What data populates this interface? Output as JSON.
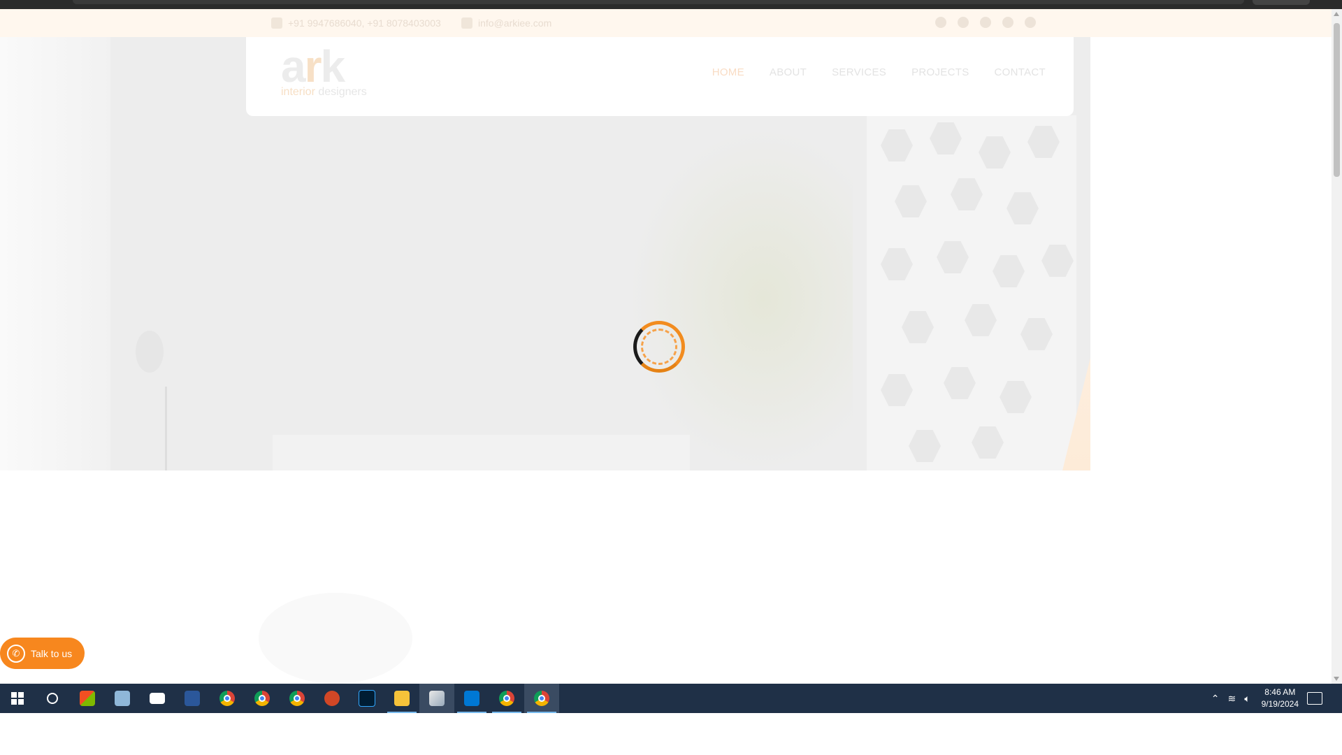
{
  "topbar": {
    "phone": "+91 9947686040, +91 8078403003",
    "email": "info@arkiee.com"
  },
  "logo": {
    "word_main": "a",
    "word_accent": "r",
    "word_end": "k",
    "tag_accent": "interior",
    "tag_rest": " designers"
  },
  "nav": {
    "items": [
      "HOME",
      "ABOUT",
      "SERVICES",
      "PROJECTS",
      "CONTACT"
    ],
    "active": "HOME"
  },
  "talk_button": {
    "label": "Talk to us"
  },
  "taskbar": {
    "time": "8:46 AM",
    "date": "9/19/2024"
  },
  "colors": {
    "accent": "#f7871e",
    "taskbar": "#1f3047"
  }
}
